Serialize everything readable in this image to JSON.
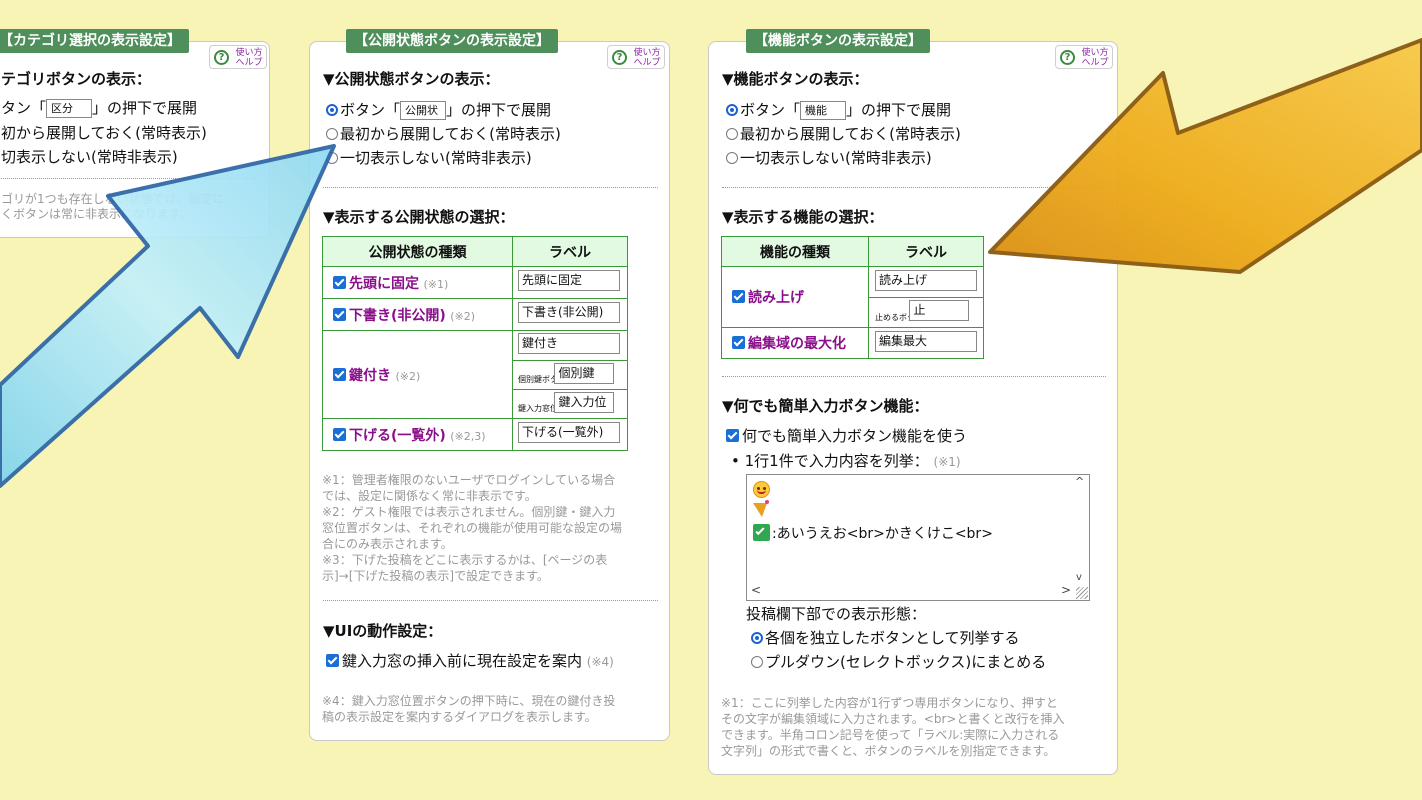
{
  "help_label": "使い方ヘルプ",
  "panel_left": {
    "title": "【カテゴリ選択の表示設定】",
    "section1": "テゴリボタンの表示：",
    "opt1_pre": "タン「",
    "opt1_box": "区分",
    "opt1_post": "」の押下で展開",
    "opt2": "初から展開しておく(常時表示)",
    "opt3": "切表示しない(常時非表示)",
    "note1": "ゴリが1つも存在しない状態では、設定に",
    "note2": "くボタンは常に非表示になります。"
  },
  "panel_mid": {
    "title": "【公開状態ボタンの表示設定】",
    "section1": "▼公開状態ボタンの表示：",
    "opt1_pre": "ボタン「",
    "opt1_box": "公開状",
    "opt1_post": "」の押下で展開",
    "opt2": "最初から展開しておく(常時表示)",
    "opt3": "一切表示しない(常時非表示)",
    "section2": "▼表示する公開状態の選択：",
    "col1": "公開状態の種類",
    "col2": "ラベル",
    "rows": {
      "pin": {
        "name": "先頭に固定",
        "note": "(※1)",
        "label": "先頭に固定"
      },
      "draft": {
        "name": "下書き(非公開)",
        "note": "(※2)",
        "label": "下書き(非公開)"
      },
      "lock": {
        "name": "鍵付き",
        "note": "(※2)",
        "label": "鍵付き",
        "sub1_cap": "個別鍵ボタン",
        "sub1_val": "個別鍵",
        "sub2_cap": "鍵入力窓位置",
        "sub2_val": "鍵入力位"
      },
      "down": {
        "name": "下げる(一覧外)",
        "note": "(※2,3)",
        "label": "下げる(一覧外)"
      }
    },
    "notes": [
      "※1：管理者権限のないユーザでログインしている場合",
      "では、設定に関係なく常に非表示です。",
      "※2：ゲスト権限では表示されません。個別鍵・鍵入力",
      "窓位置ボタンは、それぞれの機能が使用可能な設定の場",
      "合にのみ表示されます。",
      "※3：下げた投稿をどこに表示するかは、[ページの表",
      "示]→[下げた投稿の表示]で設定できます。"
    ],
    "section3": "▼UIの動作設定：",
    "ui_check": "鍵入力窓の挿入前に現在設定を案内",
    "ui_note": "(※4)",
    "notes4": [
      "※4：鍵入力窓位置ボタンの押下時に、現在の鍵付き投",
      "稿の表示設定を案内するダイアログを表示します。"
    ]
  },
  "panel_right": {
    "title": "【機能ボタンの表示設定】",
    "section1": "▼機能ボタンの表示：",
    "opt1_pre": "ボタン「",
    "opt1_box": "機能",
    "opt1_post": "」の押下で展開",
    "opt2": "最初から展開しておく(常時表示)",
    "opt3": "一切表示しない(常時非表示)",
    "section2": "▼表示する機能の選択：",
    "col1": "機能の種類",
    "col2": "ラベル",
    "rows": {
      "read": {
        "name": "読み上げ",
        "label": "読み上げ",
        "sub_cap": "止めるボタン",
        "sub_val": "止"
      },
      "max": {
        "name": "編集域の最大化",
        "label": "編集最大"
      }
    },
    "section3": "▼何でも簡単入力ボタン機能：",
    "easy_check": "何でも簡単入力ボタン機能を使う",
    "list_label": "1行1件で入力内容を列挙：",
    "list_note": "(※1)",
    "textarea_line3": ":あいうえお<br>かきくけこ<br>",
    "display_label": "投稿欄下部での表示形態：",
    "disp_opt1": "各個を独立したボタンとして列挙する",
    "disp_opt2": "プルダウン(セレクトボックス)にまとめる",
    "notes": [
      "※1：ここに列挙した内容が1行ずつ専用ボタンになり、押すと",
      "その文字が編集領域に入力されます。<br>と書くと改行を挿入",
      "できます。半角コロン記号を使って「ラベル:実際に入力される",
      "文字列」の形式で書くと、ボタンのラベルを別指定できます。"
    ]
  },
  "colors": {
    "background": "#f7f4b6",
    "title_bg": "#4f8f5b",
    "label_purple": "#8a0f8a",
    "checkbox_blue": "#1a6fd6",
    "arrow_blue": "#9fe0f4",
    "arrow_orange": "#f0b020"
  }
}
